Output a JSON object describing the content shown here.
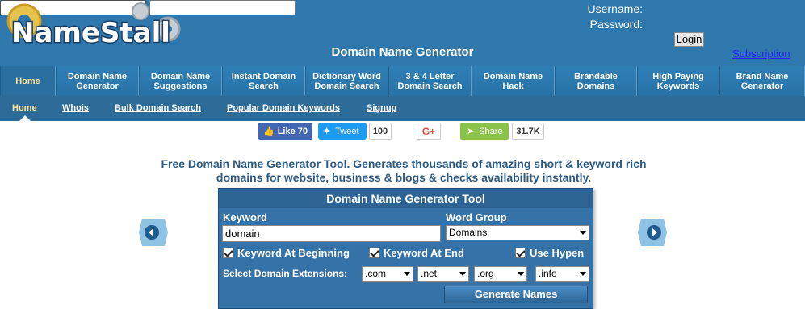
{
  "header": {
    "logo_text": "NameStall",
    "page_title": "Domain Name Generator",
    "username_label": "Username:",
    "password_label": "Password:",
    "login_label": "Login",
    "subscription_label": "Subscription"
  },
  "mainnav": [
    {
      "label": "Home"
    },
    {
      "label": "Domain Name Generator"
    },
    {
      "label": "Domain Name Suggestions"
    },
    {
      "label": "Instant Domain Search"
    },
    {
      "label": "Dictionary Word Domain Search"
    },
    {
      "label": "3 & 4 Letter Domain Search"
    },
    {
      "label": "Domain Name Hack"
    },
    {
      "label": "Brandable Domains"
    },
    {
      "label": "High Paying Keywords"
    },
    {
      "label": "Brand Name Generator"
    }
  ],
  "subnav": {
    "home": "Home",
    "whois": "Whois",
    "bulk": "Bulk Domain Search",
    "popular": "Popular Domain Keywords",
    "signup": "Signup"
  },
  "social": {
    "like_label": "Like 70",
    "tweet_label": "Tweet",
    "tweet_count": "100",
    "gplus_label": "G+",
    "share_label": "Share",
    "share_count": "31.7K"
  },
  "tagline": "Free Domain Name Generator Tool. Generates thousands of amazing short & keyword rich domains for website, business & blogs & checks availability instantly.",
  "tool": {
    "title": "Domain Name Generator Tool",
    "keyword_label": "Keyword",
    "keyword_value": "domain",
    "word_group_label": "Word Group",
    "word_group_value": "Domains",
    "chk_beginning": "Keyword At Beginning",
    "chk_end": "Keyword At End",
    "chk_hypen": "Use Hypen",
    "ext_label": "Select Domain Extensions:",
    "ext1": ".com",
    "ext2": ".net",
    "ext3": ".org",
    "ext4": ".info",
    "generate_label": "Generate Names"
  },
  "colors": {
    "header_bg": "#2e78ad",
    "nav_active_text": "#ffe49a",
    "tool_bg": "#3572a8",
    "tagline": "#2c5a86"
  }
}
